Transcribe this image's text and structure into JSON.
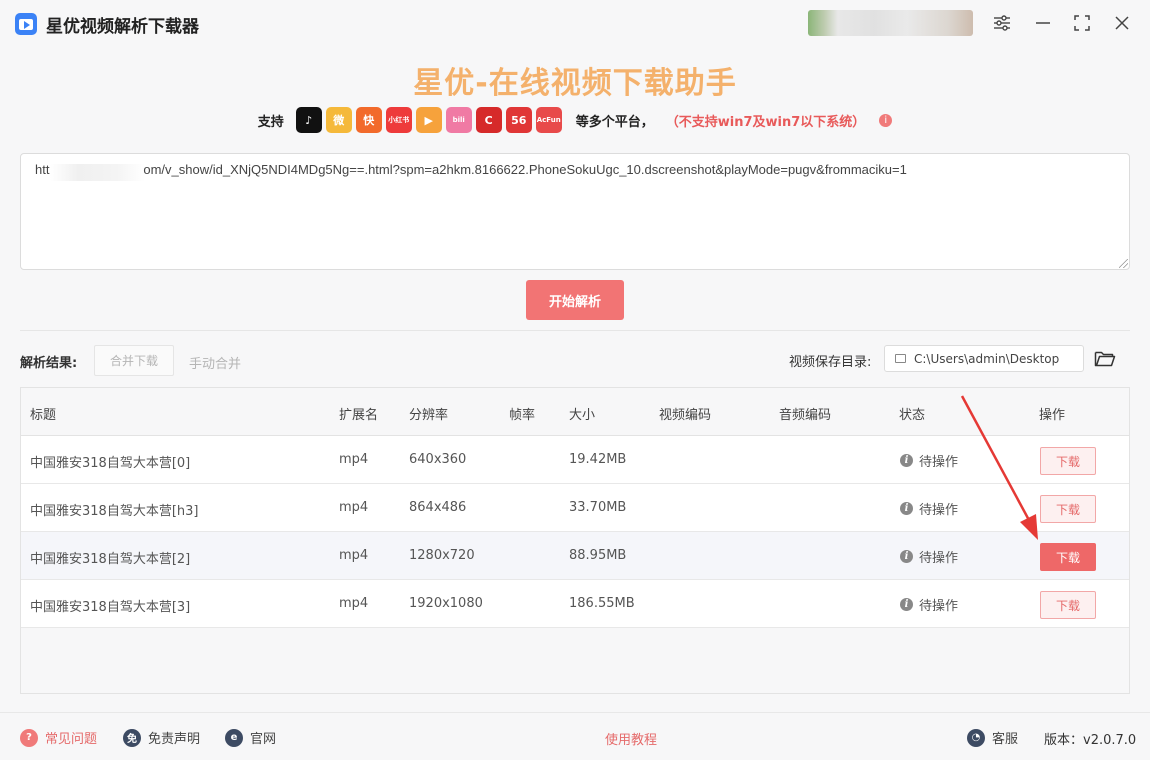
{
  "app": {
    "title": "星优视频解析下载器",
    "heading": "星优-在线视频下载助手"
  },
  "platforms": {
    "support_label": "支持",
    "icons": [
      {
        "name": "douyin-icon",
        "glyph": "♪",
        "color": "#111111"
      },
      {
        "name": "weibo-icon",
        "glyph": "微",
        "color": "#f5b93a"
      },
      {
        "name": "kuaishou-icon",
        "glyph": "快",
        "color": "#f26a2b"
      },
      {
        "name": "xiaohongshu-icon",
        "glyph": "小红书",
        "color": "#ee3b3b"
      },
      {
        "name": "tencent-video-icon",
        "glyph": "▶",
        "color": "#f6a23c"
      },
      {
        "name": "bilibili-icon",
        "glyph": "bili",
        "color": "#f07aa4"
      },
      {
        "name": "cctv-icon",
        "glyph": "C",
        "color": "#d62a2a"
      },
      {
        "name": "56-icon",
        "glyph": "56",
        "color": "#e03636"
      },
      {
        "name": "acfun-icon",
        "glyph": "AcFun",
        "color": "#e84a4a"
      }
    ],
    "more_text": "等多个平台，",
    "warning": "（不支持win7及win7以下系统）"
  },
  "url_input": {
    "value": "htt                          om/v_show/id_XNjQ5NDI4MDg5Ng==.html?spm=a2hkm.8166622.PhoneSokuUgc_10.dscreenshot&playMode=pugv&frommaciku=1"
  },
  "parse_button": "开始解析",
  "results": {
    "label": "解析结果:",
    "merge_download": "合并下载",
    "manual_merge": "手动合并",
    "save_dir_label": "视频保存目录:",
    "save_dir_value": "C:\\Users\\admin\\Desktop"
  },
  "table": {
    "headers": {
      "title": "标题",
      "ext": "扩展名",
      "resolution": "分辨率",
      "fps": "帧率",
      "size": "大小",
      "video_codec": "视频编码",
      "audio_codec": "音频编码",
      "status": "状态",
      "action": "操作"
    },
    "rows": [
      {
        "title": "中国雅安318自驾大本营[0]",
        "ext": "mp4",
        "resolution": "640x360",
        "fps": "",
        "size": "19.42MB",
        "video_codec": "",
        "audio_codec": "",
        "status": "待操作",
        "action": "下载"
      },
      {
        "title": "中国雅安318自驾大本营[h3]",
        "ext": "mp4",
        "resolution": "864x486",
        "fps": "",
        "size": "33.70MB",
        "video_codec": "",
        "audio_codec": "",
        "status": "待操作",
        "action": "下载"
      },
      {
        "title": "中国雅安318自驾大本营[2]",
        "ext": "mp4",
        "resolution": "1280x720",
        "fps": "",
        "size": "88.95MB",
        "video_codec": "",
        "audio_codec": "",
        "status": "待操作",
        "action": "下载"
      },
      {
        "title": "中国雅安318自驾大本营[3]",
        "ext": "mp4",
        "resolution": "1920x1080",
        "fps": "",
        "size": "186.55MB",
        "video_codec": "",
        "audio_codec": "",
        "status": "待操作",
        "action": "下载"
      }
    ]
  },
  "footer": {
    "faq": "常见问题",
    "disclaimer": "免责声明",
    "website": "官网",
    "tutorial": "使用教程",
    "support": "客服",
    "version": "版本：v2.0.7.0"
  },
  "colors": {
    "accent": "#f27474",
    "heading": "#f4b16c",
    "warning": "#e85a5a"
  }
}
